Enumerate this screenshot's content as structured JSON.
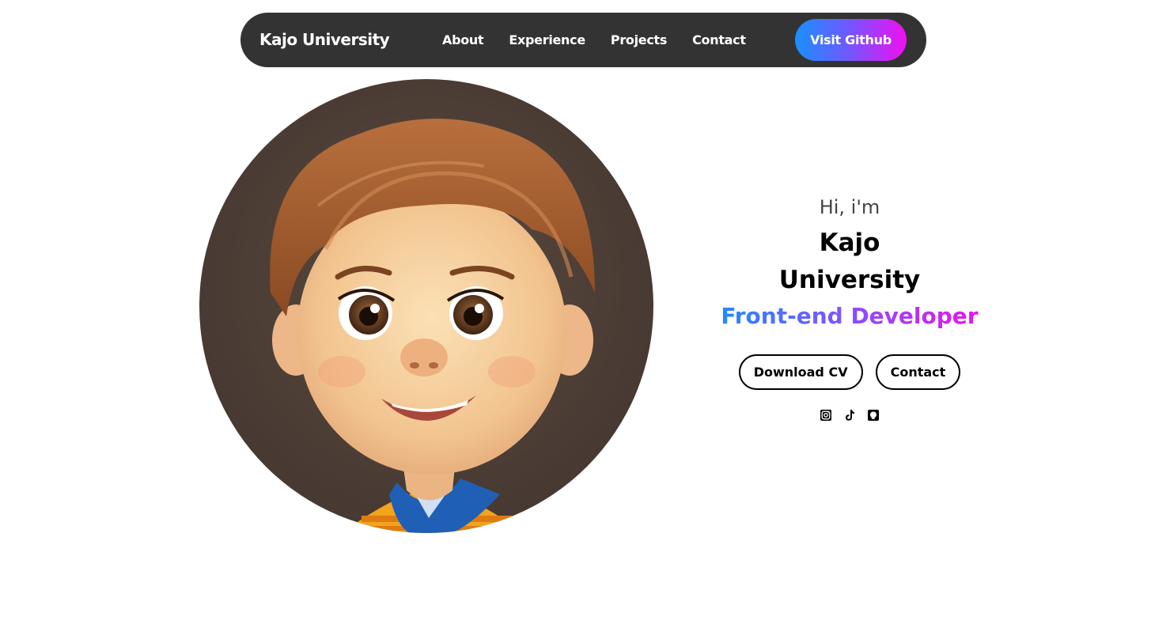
{
  "nav": {
    "brand": "Kajo University",
    "links": [
      "About",
      "Experience",
      "Projects",
      "Contact"
    ],
    "cta": "Visit Github"
  },
  "hero": {
    "greeting": "Hi, i'm",
    "name_line1": "Kajo",
    "name_line2": "University",
    "role": "Front-end Developer",
    "buttons": {
      "download": "Download CV",
      "contact": "Contact"
    },
    "socials": [
      "instagram-icon",
      "tiktok-icon",
      "github-icon"
    ]
  },
  "colors": {
    "nav_bg": "#333333",
    "gradient_start": "#1a8fff",
    "gradient_end": "#f00ff0"
  }
}
